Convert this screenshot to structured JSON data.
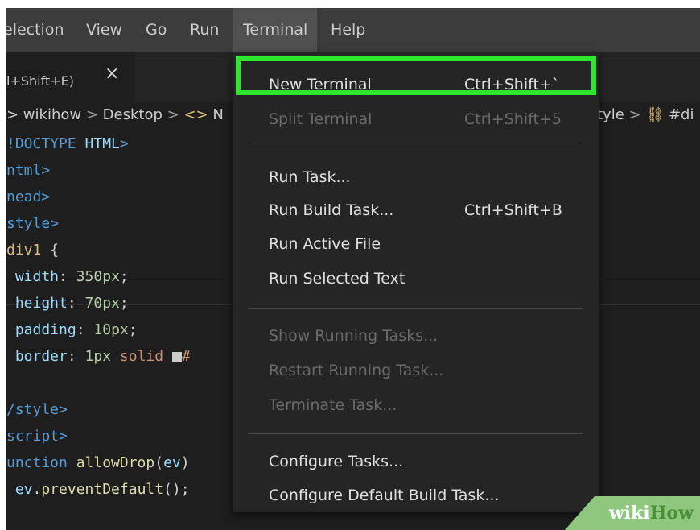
{
  "menubar": {
    "items": [
      "election",
      "View",
      "Go",
      "Run",
      "Terminal",
      "Help"
    ],
    "active": "Terminal"
  },
  "tab": {
    "label": "l+Shift+E)",
    "close": "×"
  },
  "breadcrumb": {
    "parts": [
      "> wikihow",
      ">",
      "Desktop",
      ">",
      "<>",
      "N"
    ],
    "right_parts": [
      "tyle",
      ">",
      "#di"
    ]
  },
  "code": {
    "lines": [
      [
        {
          "t": "!DOCTYPE ",
          "c": "tag"
        },
        {
          "t": "HTML",
          "c": "prop"
        },
        {
          "t": ">",
          "c": "tag"
        }
      ],
      [
        {
          "t": "ntml",
          "c": "tag"
        },
        {
          "t": ">",
          "c": "tag"
        }
      ],
      [
        {
          "t": "nead",
          "c": "tag"
        },
        {
          "t": ">",
          "c": "tag"
        }
      ],
      [
        {
          "t": "style",
          "c": "tag"
        },
        {
          "t": ">",
          "c": "tag"
        }
      ],
      [
        {
          "t": "div1",
          "c": "sel"
        },
        {
          "t": " {",
          "c": ""
        }
      ],
      [
        {
          "t": " width",
          "c": "prop"
        },
        {
          "t": ": ",
          "c": ""
        },
        {
          "t": "350px",
          "c": "num"
        },
        {
          "t": ";",
          "c": ""
        }
      ],
      [
        {
          "t": " height",
          "c": "prop"
        },
        {
          "t": ": ",
          "c": ""
        },
        {
          "t": "70px",
          "c": "num"
        },
        {
          "t": ";",
          "c": ""
        }
      ],
      [
        {
          "t": " padding",
          "c": "prop"
        },
        {
          "t": ": ",
          "c": ""
        },
        {
          "t": "10px",
          "c": "num"
        },
        {
          "t": ";",
          "c": ""
        }
      ],
      [
        {
          "t": " border",
          "c": "prop"
        },
        {
          "t": ": ",
          "c": ""
        },
        {
          "t": "1px",
          "c": "num"
        },
        {
          "t": " solid ",
          "c": "str"
        },
        {
          "t": "SWATCH",
          "c": "swatch"
        },
        {
          "t": "#",
          "c": "str"
        }
      ],
      [],
      [
        {
          "t": "/style",
          "c": "tag"
        },
        {
          "t": ">",
          "c": "tag"
        }
      ],
      [
        {
          "t": "script",
          "c": "tag"
        },
        {
          "t": ">",
          "c": "tag"
        }
      ],
      [
        {
          "t": "unction ",
          "c": "kw"
        },
        {
          "t": "allowDrop",
          "c": "fn"
        },
        {
          "t": "(",
          "c": ""
        },
        {
          "t": "ev",
          "c": "prop"
        },
        {
          "t": ")",
          "c": ""
        }
      ],
      [
        {
          "t": " ev",
          "c": "prop"
        },
        {
          "t": ".",
          "c": ""
        },
        {
          "t": "preventDefault",
          "c": "fn"
        },
        {
          "t": "();",
          "c": ""
        }
      ]
    ]
  },
  "terminal_menu": {
    "items": [
      {
        "label": "New Terminal",
        "shortcut": "Ctrl+Shift+`",
        "disabled": false
      },
      {
        "label": "Split Terminal",
        "shortcut": "Ctrl+Shift+5",
        "disabled": true
      },
      {
        "sep": true
      },
      {
        "label": "Run Task...",
        "shortcut": "",
        "disabled": false
      },
      {
        "label": "Run Build Task...",
        "shortcut": "Ctrl+Shift+B",
        "disabled": false
      },
      {
        "label": "Run Active File",
        "shortcut": "",
        "disabled": false
      },
      {
        "label": "Run Selected Text",
        "shortcut": "",
        "disabled": false
      },
      {
        "sep": true
      },
      {
        "label": "Show Running Tasks...",
        "shortcut": "",
        "disabled": true
      },
      {
        "label": "Restart Running Task...",
        "shortcut": "",
        "disabled": true
      },
      {
        "label": "Terminate Task...",
        "shortcut": "",
        "disabled": true
      },
      {
        "sep": true
      },
      {
        "label": "Configure Tasks...",
        "shortcut": "",
        "disabled": false
      },
      {
        "label": "Configure Default Build Task...",
        "shortcut": "",
        "disabled": false
      }
    ]
  },
  "watermark": {
    "part1": "wiki",
    "part2": "How"
  },
  "colors": {
    "highlight": "#2ee62e",
    "menu_bg": "#252526",
    "editor_bg": "#1e1e1e"
  }
}
